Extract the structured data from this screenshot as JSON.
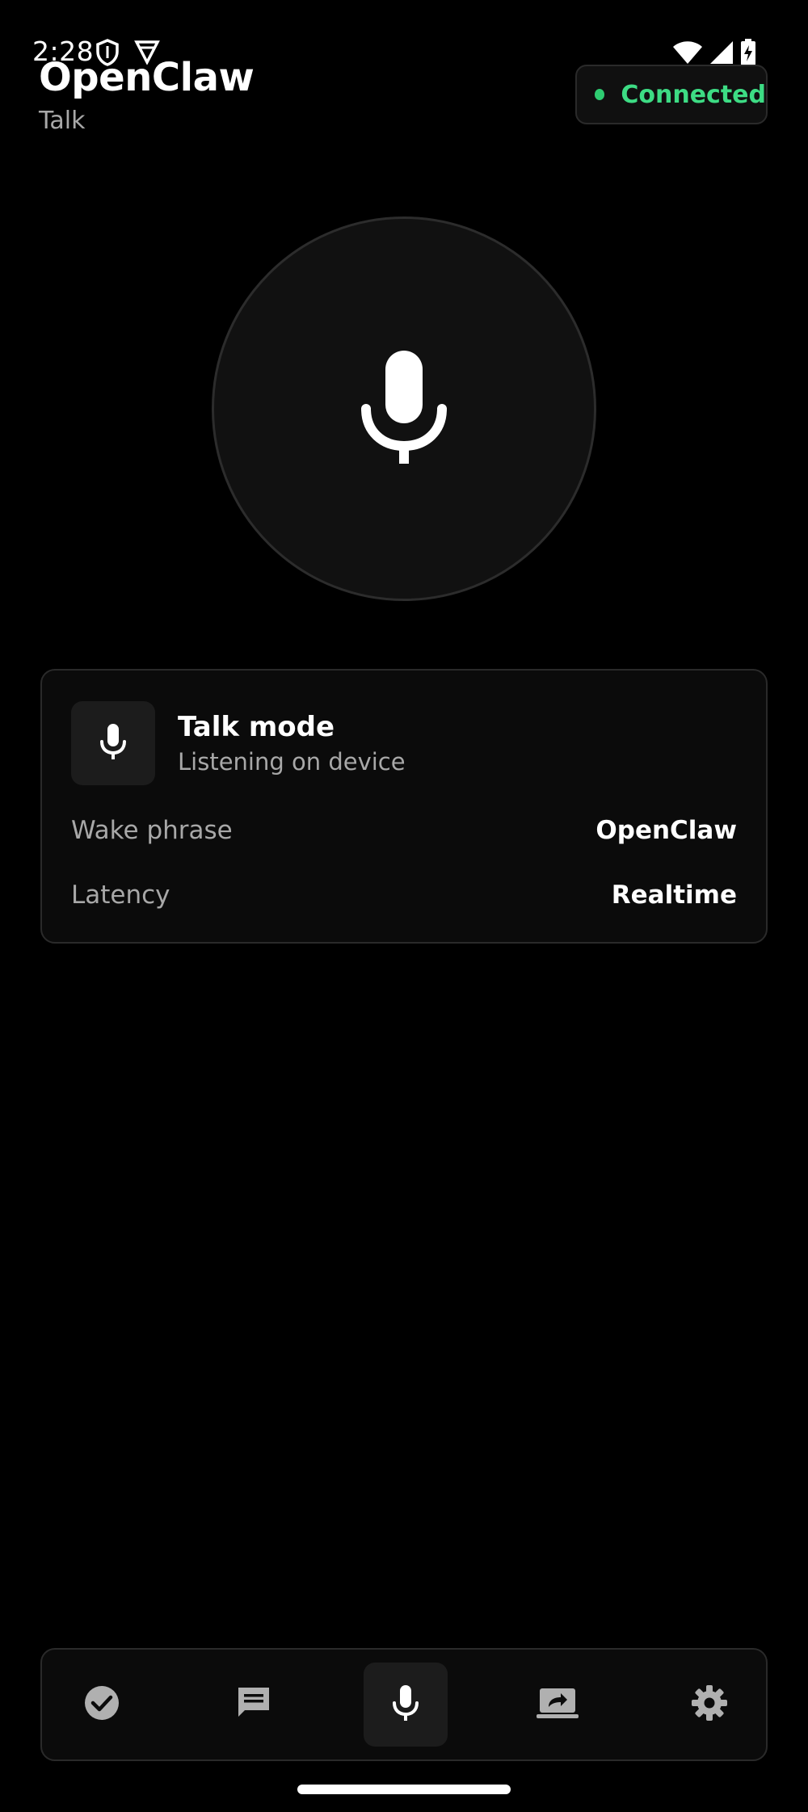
{
  "status_bar": {
    "time": "2:28",
    "left_icons": [
      "shield-icon",
      "vpn-icon"
    ],
    "right_icons": [
      "wifi-icon",
      "signal-icon",
      "battery-charging-icon"
    ]
  },
  "header": {
    "title": "OpenClaw",
    "subtitle": "Talk",
    "connection_status": "Connected",
    "connection_color": "#3ddc84"
  },
  "mic_button": {
    "icon": "microphone-icon"
  },
  "talk_card": {
    "icon": "microphone-icon",
    "title": "Talk mode",
    "subtitle": "Listening on device",
    "rows": [
      {
        "label": "Wake phrase",
        "value": "OpenClaw"
      },
      {
        "label": "Latency",
        "value": "Realtime"
      }
    ]
  },
  "bottom_nav": {
    "items": [
      {
        "icon": "check-circle-icon",
        "active": false
      },
      {
        "icon": "chat-icon",
        "active": false
      },
      {
        "icon": "microphone-icon",
        "active": true
      },
      {
        "icon": "screen-share-icon",
        "active": false
      },
      {
        "icon": "gear-icon",
        "active": false
      }
    ]
  },
  "colors": {
    "background": "#000000",
    "card_background": "#0b0b0b",
    "border": "#2a2a2a",
    "accent_green": "#3ddc84"
  }
}
